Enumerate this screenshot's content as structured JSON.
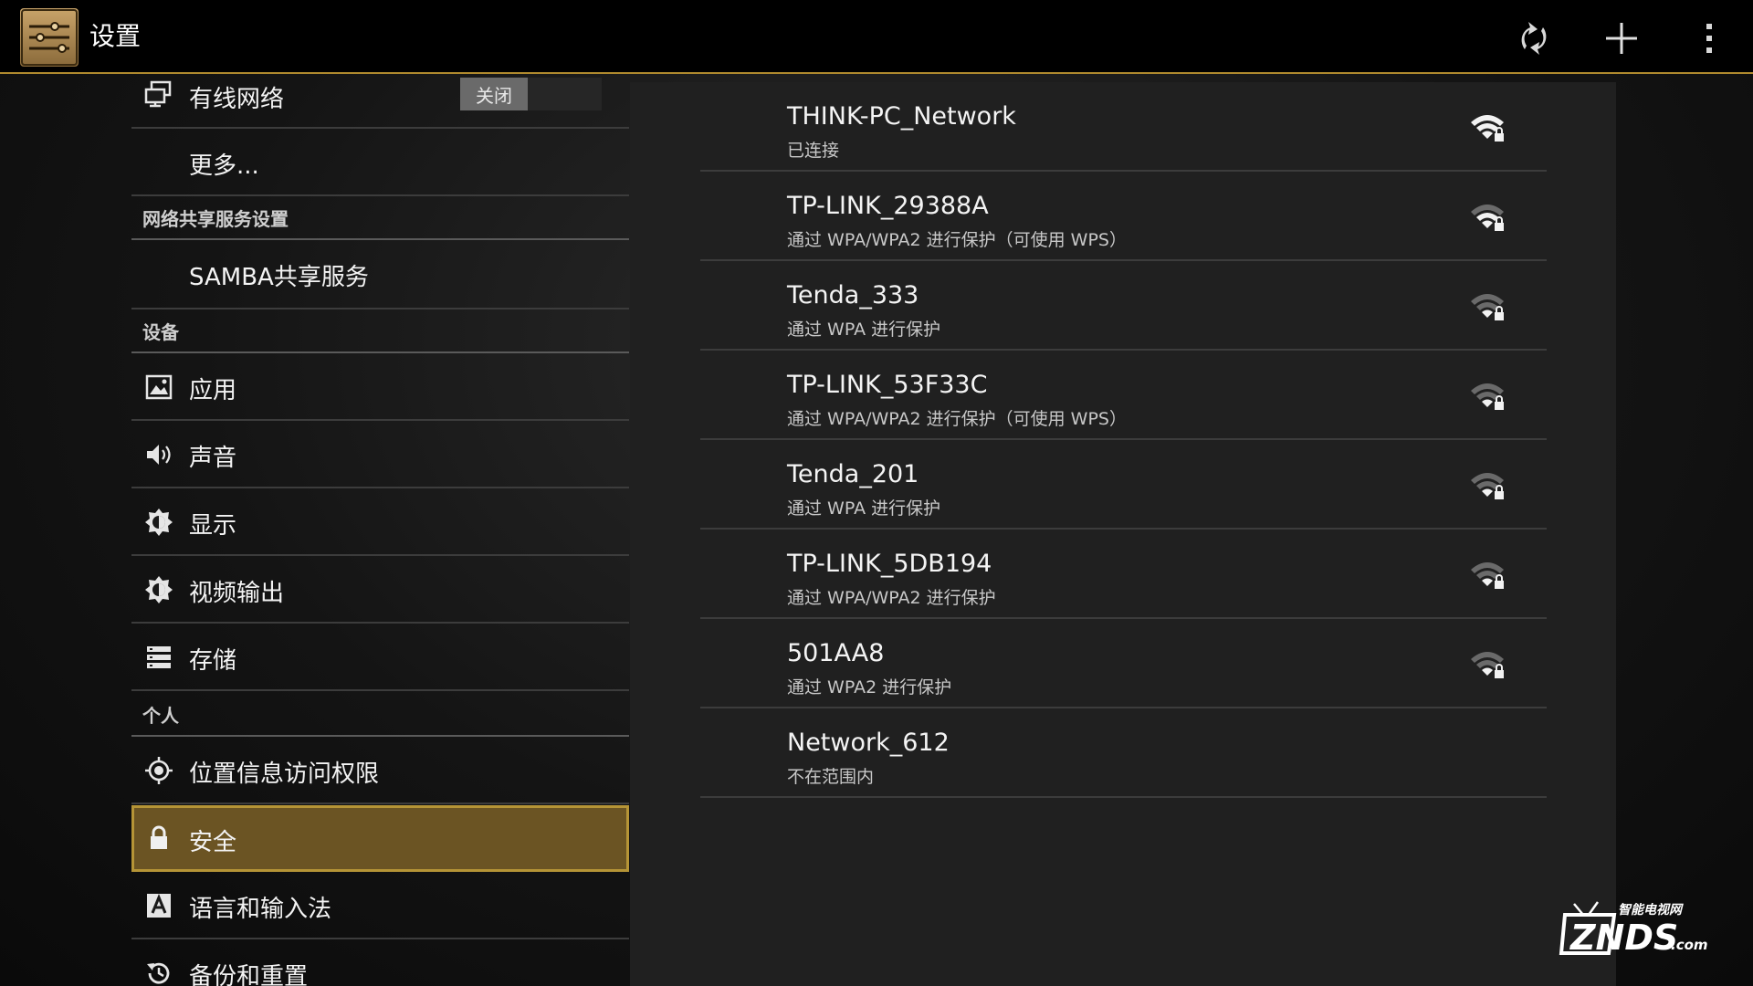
{
  "actionbar": {
    "title": "设置",
    "app_icon": "settings-sliders-icon",
    "actions": [
      "wps-refresh-icon",
      "add-icon",
      "overflow-menu-icon"
    ]
  },
  "sidebar": {
    "wired": {
      "label": "有线网络",
      "toggle": "关闭"
    },
    "more": {
      "label": "更多..."
    },
    "header_sharing": "网络共享服务设置",
    "samba": {
      "label": "SAMBA共享服务"
    },
    "header_device": "设备",
    "apps": {
      "label": "应用"
    },
    "sound": {
      "label": "声音"
    },
    "display": {
      "label": "显示"
    },
    "video_out": {
      "label": "视频输出"
    },
    "storage": {
      "label": "存储"
    },
    "header_personal": "个人",
    "location": {
      "label": "位置信息访问权限"
    },
    "security": {
      "label": "安全"
    },
    "language": {
      "label": "语言和输入法"
    },
    "backup": {
      "label": "备份和重置"
    }
  },
  "wifi": {
    "networks": [
      {
        "ssid": "THINK-PC_Network",
        "status": "已连接",
        "signal": 4
      },
      {
        "ssid": "TP-LINK_29388A",
        "status": "通过 WPA/WPA2 进行保护（可使用 WPS）",
        "signal": 3
      },
      {
        "ssid": "Tenda_333",
        "status": "通过 WPA 进行保护",
        "signal": 2
      },
      {
        "ssid": "TP-LINK_53F33C",
        "status": "通过 WPA/WPA2 进行保护（可使用 WPS）",
        "signal": 2
      },
      {
        "ssid": "Tenda_201",
        "status": "通过 WPA 进行保护",
        "signal": 2
      },
      {
        "ssid": "TP-LINK_5DB194",
        "status": "通过 WPA/WPA2 进行保护",
        "signal": 2
      },
      {
        "ssid": "501AA8",
        "status": "通过 WPA2 进行保护",
        "signal": 2
      },
      {
        "ssid": "Network_612",
        "status": "不在范围内",
        "signal": 0
      }
    ]
  },
  "colors": {
    "accent": "#b08a2e",
    "selected_bg": "#6b5423",
    "pane_bg": "#202020"
  },
  "watermark": {
    "brand": "ZNDS",
    "suffix": ".com",
    "tagline": "智能电视网"
  }
}
